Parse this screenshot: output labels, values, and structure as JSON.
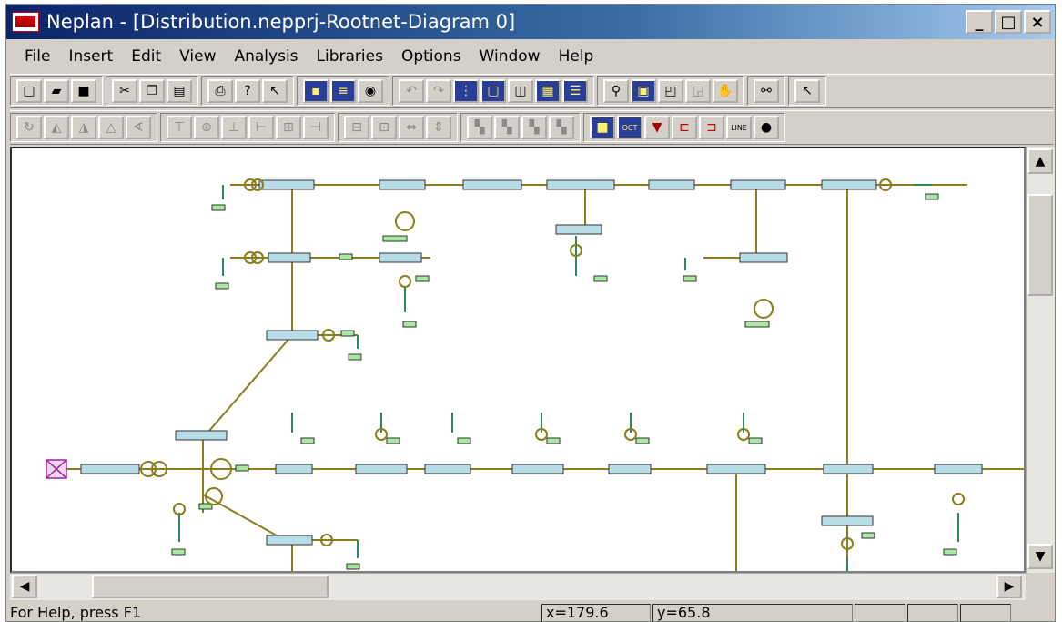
{
  "window": {
    "title": "Neplan - [Distribution.nepprj-Rootnet-Diagram 0]",
    "minimize_symbol": "_",
    "maximize_symbol": "□",
    "close_symbol": "×"
  },
  "menu": {
    "items": [
      "File",
      "Insert",
      "Edit",
      "View",
      "Analysis",
      "Libraries",
      "Options",
      "Window",
      "Help"
    ]
  },
  "toolbar1": {
    "icons": [
      "new-icon",
      "open-icon",
      "save-icon",
      "cut-icon",
      "copy-icon",
      "paste-icon",
      "print-icon",
      "help-icon",
      "context-help-icon",
      "network-icon",
      "element-icon",
      "connect-icon",
      "undo-icon",
      "redo-icon",
      "grid-icon",
      "select-area-icon",
      "split-icon",
      "table-icon",
      "list-icon",
      "zoom-icon",
      "fit-icon",
      "zoom-window-icon",
      "zoom-all-icon",
      "pan-icon",
      "find-icon",
      "pointer-icon"
    ]
  },
  "toolbar2": {
    "icons": [
      "rotate-icon",
      "mirror-icon",
      "flip-icon",
      "align-icon",
      "angle-icon",
      "align-top-icon",
      "align-middle-icon",
      "align-bottom-icon",
      "align-left-icon",
      "align-center-icon",
      "align-right-icon",
      "distribute-v-icon",
      "distribute-h-icon",
      "space-h-icon",
      "space-v-icon",
      "layer1-icon",
      "layer2-icon",
      "layer3-icon",
      "layer4-icon",
      "node-icon",
      "oct-icon",
      "load-icon",
      "switch-icon",
      "switch2-icon",
      "line-icon",
      "dot-icon"
    ],
    "oct_label": "OCT",
    "line_label": "LINE"
  },
  "status": {
    "help": "For Help, press F1",
    "x": "x=179.6",
    "y": "y=65.8"
  },
  "colors": {
    "line": "#8a7d1e",
    "busbar": "#b8dde8",
    "label": "#a8e8a0",
    "feeder": "#2a8a5a",
    "infeeder": "#a020a0"
  }
}
